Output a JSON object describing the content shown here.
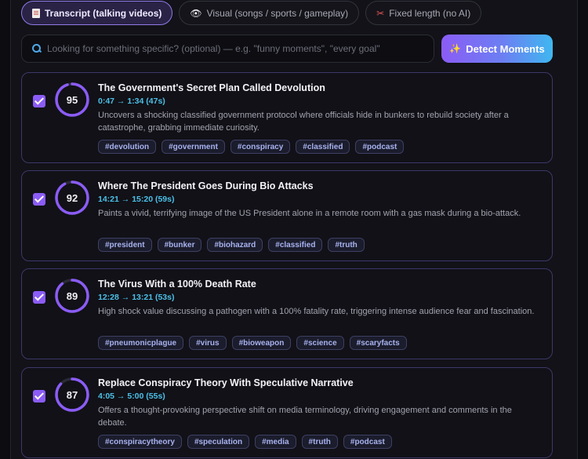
{
  "tabs": [
    {
      "label": "Transcript (talking videos)",
      "icon": "document-icon",
      "active": true
    },
    {
      "label": "Visual (songs / sports / gameplay)",
      "icon": "eye-icon",
      "active": false
    },
    {
      "label": "Fixed length (no AI)",
      "icon": "scissors-icon",
      "active": false
    }
  ],
  "search": {
    "placeholder": "Looking for something specific? (optional) — e.g. \"funny moments\", \"every goal\"",
    "value": ""
  },
  "detect_button": {
    "label": "Detect Moments",
    "icon": "sparkles-icon"
  },
  "colors": {
    "accent": "#8b5cf6",
    "time": "#4cc0e8",
    "tag_text": "#a8b3f0"
  },
  "moments": [
    {
      "checked": true,
      "score": "95",
      "score_fraction": 0.95,
      "title": "The Government's Secret Plan Called Devolution",
      "time": "0:47 → 1:34 (47s)",
      "description": "Uncovers a shocking classified government protocol where officials hide in bunkers to rebuild society after a catastrophe, grabbing immediate curiosity.",
      "tags": [
        "#devolution",
        "#government",
        "#conspiracy",
        "#classified",
        "#podcast"
      ]
    },
    {
      "checked": true,
      "score": "92",
      "score_fraction": 0.92,
      "title": "Where The President Goes During Bio Attacks",
      "time": "14:21 → 15:20 (59s)",
      "description": "Paints a vivid, terrifying image of the US President alone in a remote room with a gas mask during a bio-attack.",
      "tags": [
        "#president",
        "#bunker",
        "#biohazard",
        "#classified",
        "#truth"
      ]
    },
    {
      "checked": true,
      "score": "89",
      "score_fraction": 0.89,
      "title": "The Virus With a 100% Death Rate",
      "time": "12:28 → 13:21 (53s)",
      "description": "High shock value discussing a pathogen with a 100% fatality rate, triggering intense audience fear and fascination.",
      "tags": [
        "#pneumonicplague",
        "#virus",
        "#bioweapon",
        "#science",
        "#scaryfacts"
      ]
    },
    {
      "checked": true,
      "score": "87",
      "score_fraction": 0.87,
      "title": "Replace Conspiracy Theory With Speculative Narrative",
      "time": "4:05 → 5:00 (55s)",
      "description": "Offers a thought-provoking perspective shift on media terminology, driving engagement and comments in the debate.",
      "tags": [
        "#conspiracytheory",
        "#speculation",
        "#media",
        "#truth",
        "#podcast"
      ]
    }
  ]
}
